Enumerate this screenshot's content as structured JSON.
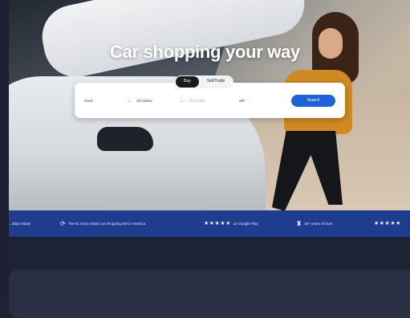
{
  "hero": {
    "headline": "Car shopping your way"
  },
  "search": {
    "tabs": [
      {
        "label": "Buy",
        "active": true
      },
      {
        "label": "Sell/Trade",
        "active": false
      }
    ],
    "fields": {
      "condition": "Used",
      "make": "All makes",
      "model": "All models",
      "zip": "ZIP"
    },
    "button_label": "Search"
  },
  "trust_bar": {
    "items": [
      {
        "text": "...tdays Ebay!"
      },
      {
        "text": "The #1 most visited car shopping site in America"
      },
      {
        "text": "on Google Play",
        "stars": "★★★★★"
      },
      {
        "text": "15+ years of trust"
      },
      {
        "text": "",
        "stars": "★★★★★"
      }
    ]
  },
  "colors": {
    "accent": "#1f61d6",
    "trust_bar_bg": "#1f3d8f",
    "page_bg": "#1e2235"
  }
}
